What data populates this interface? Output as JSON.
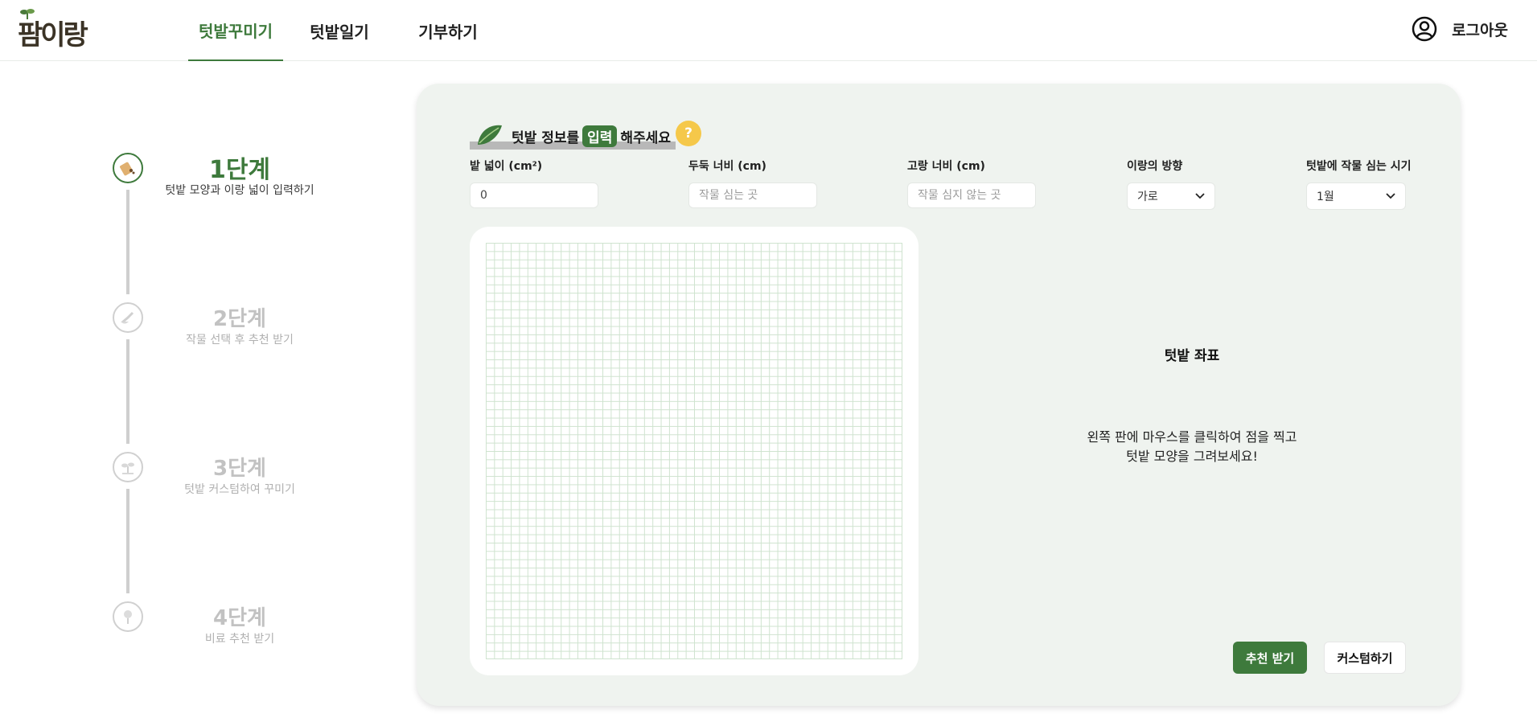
{
  "header": {
    "logo_text": "팜이랑",
    "nav": [
      {
        "label": "텃밭꾸미기",
        "active": true
      },
      {
        "label": "텃밭일기",
        "active": false
      },
      {
        "label": "기부하기",
        "active": false
      }
    ],
    "logout_label": "로그아웃",
    "accent_color": "#3e7a3c"
  },
  "stepper": {
    "steps": [
      {
        "title": "1단계",
        "desc": "텃밭 모양과 이랑 넓이 입력하기",
        "active": true,
        "icon": "seed-packet-icon"
      },
      {
        "title": "2단계",
        "desc": "작물 선택 후 추천 받기",
        "active": false,
        "icon": "shovel-icon"
      },
      {
        "title": "3단계",
        "desc": "텃밭 커스텀하여 꾸미기",
        "active": false,
        "icon": "sprout-icon"
      },
      {
        "title": "4단계",
        "desc": "비료 추천 받기",
        "active": false,
        "icon": "flower-icon"
      }
    ]
  },
  "panel": {
    "title_prefix": "텃밭 정보를",
    "title_highlight": "입력",
    "title_suffix": "해주세요",
    "help_label": "?",
    "fields": {
      "area": {
        "label": "밭 넓이 (cm²)",
        "value": "0"
      },
      "ridge_width": {
        "label": "두둑 너비 (cm)",
        "placeholder": "작물 심는 곳"
      },
      "furrow_width": {
        "label": "고랑 너비 (cm)",
        "placeholder": "작물 심지 않는 곳"
      },
      "direction": {
        "label": "이랑의 방향",
        "value": "가로"
      },
      "planting_time": {
        "label": "텃밭에 작물 심는 시기",
        "value": "1월"
      }
    },
    "coord_title": "텃밭 좌표",
    "coord_hint_line1": "왼쪽 판에 마우스를 클릭하여 점을 찍고",
    "coord_hint_line2": "텃밭 모양을 그려보세요!",
    "recommend_button": "추천 받기",
    "custom_button": "커스텀하기"
  }
}
